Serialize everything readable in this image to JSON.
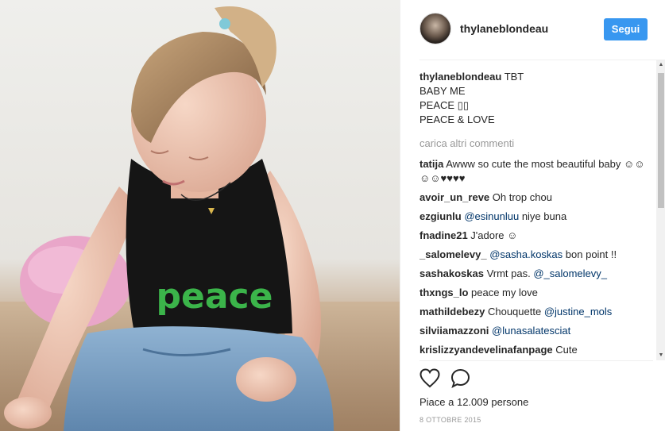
{
  "post": {
    "username": "thylaneblondeau",
    "follow_label": "Segui",
    "shirt_text": "peace",
    "caption": {
      "user": "thylaneblondeau",
      "lines": [
        "TBT",
        "BABY ME",
        "PEACE ▯▯",
        "PEACE & LOVE"
      ]
    },
    "load_more": "carica altri commenti",
    "comments": [
      {
        "user": "tatija",
        "parts": [
          {
            "t": " Awww so cute the most beautiful baby ☺☺☺☺♥♥♥♥"
          }
        ]
      },
      {
        "user": "avoir_un_reve",
        "parts": [
          {
            "t": " Oh trop chou"
          }
        ]
      },
      {
        "user": "ezgiunlu",
        "parts": [
          {
            "t": " "
          },
          {
            "m": "@esinunluu"
          },
          {
            "t": " niye buna"
          }
        ]
      },
      {
        "user": "fnadine21",
        "parts": [
          {
            "t": " J'adore ☺"
          }
        ]
      },
      {
        "user": "_salomelevy_",
        "parts": [
          {
            "t": " "
          },
          {
            "m": "@sasha.koskas"
          },
          {
            "t": " bon point !!"
          }
        ]
      },
      {
        "user": "sashakoskas",
        "parts": [
          {
            "t": " Vrmt pas. "
          },
          {
            "m": "@_salomelevy_"
          }
        ]
      },
      {
        "user": "thxngs_lo",
        "parts": [
          {
            "t": " peace my love"
          }
        ]
      },
      {
        "user": "mathildebezy",
        "parts": [
          {
            "t": " Chouquette "
          },
          {
            "m": "@justine_mols"
          }
        ]
      },
      {
        "user": "silviiamazzoni",
        "parts": [
          {
            "t": " "
          },
          {
            "m": "@lunasalatesciat"
          }
        ]
      },
      {
        "user": "krislizzyandevelinafanpage",
        "parts": [
          {
            "t": " Cute"
          }
        ]
      }
    ],
    "likes_text": "Piace a 12.009 persone",
    "date": "8 OTTOBRE 2015",
    "icons": {
      "like": "heart-icon",
      "comment": "comment-icon"
    },
    "colors": {
      "accent": "#3897f0",
      "mention": "#003569",
      "muted": "#999999"
    }
  }
}
